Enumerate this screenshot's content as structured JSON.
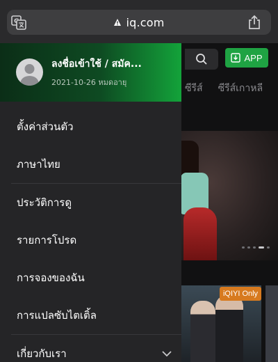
{
  "browser": {
    "url": "iq.com",
    "translate_icon": "translate-icon",
    "lock_icon": "lock-icon",
    "share_icon": "share-icon"
  },
  "page": {
    "app_label": "APP",
    "tabs": [
      "ซีรีส์",
      "ซีรีส์เกาหลี"
    ],
    "badge": "iQIYI Only",
    "accent": "#1fa343"
  },
  "drawer": {
    "profile": {
      "login_label": "ลงชื่อเข้าใช้ / สมัค...",
      "expiry": "2021-10-26 หมดอายุ"
    },
    "items": [
      {
        "label": "ตั้งค่าส่วนตัว"
      },
      {
        "label": "ภาษาไทย"
      },
      {
        "label": "ประวัติการดู"
      },
      {
        "label": "รายการโปรด"
      },
      {
        "label": "การจองของฉัน"
      },
      {
        "label": "การแปลซับไตเติ้ล"
      },
      {
        "label": "เกี่ยวกับเรา"
      }
    ]
  }
}
